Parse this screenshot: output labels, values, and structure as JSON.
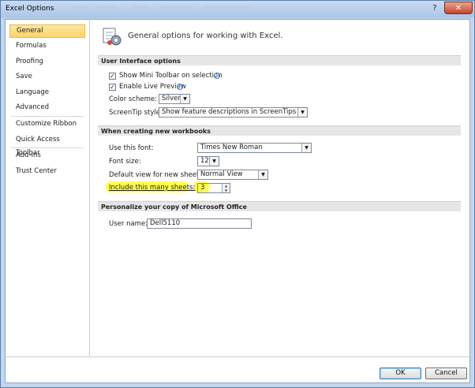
{
  "window": {
    "title": "Excel Options",
    "help_glyph": "?",
    "close_glyph": "✕"
  },
  "nav": {
    "items": [
      {
        "label": "General"
      },
      {
        "label": "Formulas"
      },
      {
        "label": "Proofing"
      },
      {
        "label": "Save"
      },
      {
        "label": "Language"
      },
      {
        "label": "Advanced"
      },
      {
        "label": "Customize Ribbon"
      },
      {
        "label": "Quick Access Toolbar"
      },
      {
        "label": "Add-Ins"
      },
      {
        "label": "Trust Center"
      }
    ],
    "selected": "General"
  },
  "main": {
    "heading": "General options for working with Excel.",
    "ui_section": {
      "title": "User Interface options",
      "mini_toolbar_label": "Show Mini Toolbar on selection",
      "mini_toolbar_checked": true,
      "live_preview_label": "Enable Live Preview",
      "live_preview_checked": true,
      "color_scheme_label": "Color scheme:",
      "color_scheme_value": "Silver",
      "screentip_label": "ScreenTip style:",
      "screentip_value": "Show feature descriptions in ScreenTips"
    },
    "workbook_section": {
      "title": "When creating new workbooks",
      "font_label": "Use this font:",
      "font_value": "Times New Roman",
      "size_label": "Font size:",
      "size_value": "12",
      "view_label": "Default view for new sheets:",
      "view_value": "Normal View",
      "sheets_label": "Include this many sheets:",
      "sheets_value": "3",
      "highlight_color": "#ffff3d"
    },
    "personalize_section": {
      "title": "Personalize your copy of Microsoft Office",
      "username_label": "User name:",
      "username_value": "Dell5110"
    }
  },
  "footer": {
    "ok_label": "OK",
    "cancel_label": "Cancel"
  },
  "icons": {
    "info": "i",
    "dropdown": "▼",
    "check": "✓",
    "spin_up": "▲",
    "spin_down": "▼"
  }
}
